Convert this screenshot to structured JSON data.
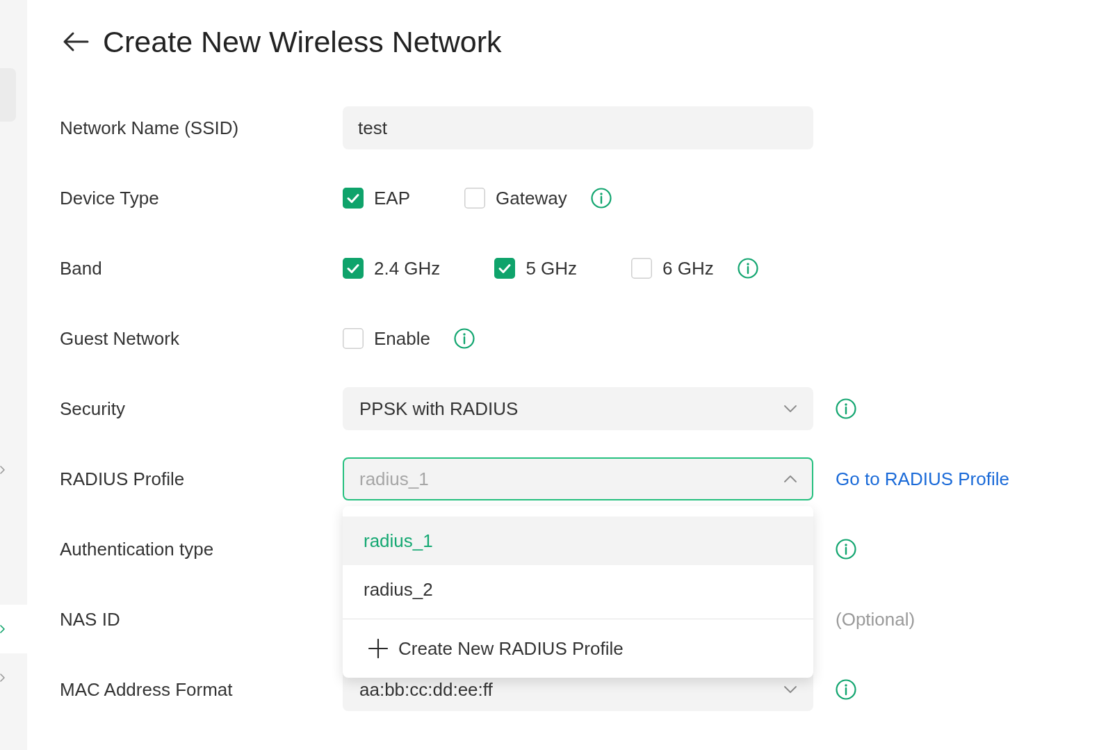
{
  "page": {
    "title": "Create New Wireless Network"
  },
  "sidebar": {
    "items": [
      {
        "selected": false
      },
      {
        "selected": true
      },
      {
        "selected": false
      }
    ]
  },
  "form": {
    "rows": [
      {
        "kind": "text",
        "label": "Network Name (SSID)",
        "value": "test"
      },
      {
        "kind": "checkboxes",
        "label": "Device Type",
        "options": [
          {
            "label": "EAP",
            "checked": true
          },
          {
            "label": "Gateway",
            "checked": false
          }
        ],
        "info": true
      },
      {
        "kind": "checkboxes",
        "label": "Band",
        "options": [
          {
            "label": "2.4 GHz",
            "checked": true
          },
          {
            "label": "5 GHz",
            "checked": true
          },
          {
            "label": "6 GHz",
            "checked": false
          }
        ],
        "info": true
      },
      {
        "kind": "checkboxes",
        "label": "Guest Network",
        "options": [
          {
            "label": "Enable",
            "checked": false
          }
        ],
        "info": true
      },
      {
        "kind": "select",
        "label": "Security",
        "value": "PPSK with RADIUS",
        "expanded": false,
        "info": true
      },
      {
        "kind": "select",
        "label": "RADIUS Profile",
        "value": "radius_1",
        "expanded": true,
        "link": "Go to RADIUS Profile",
        "menu": {
          "options": [
            {
              "label": "radius_1",
              "selected": true
            },
            {
              "label": "radius_2",
              "selected": false
            }
          ],
          "action": "Create New RADIUS Profile"
        }
      },
      {
        "kind": "covered",
        "label": "Authentication type",
        "info": true
      },
      {
        "kind": "covered",
        "label": "NAS ID",
        "note": "(Optional)"
      },
      {
        "kind": "select",
        "label": "MAC Address Format",
        "value": "aa:bb:cc:dd:ee:ff",
        "expanded": false,
        "info": true
      }
    ]
  }
}
